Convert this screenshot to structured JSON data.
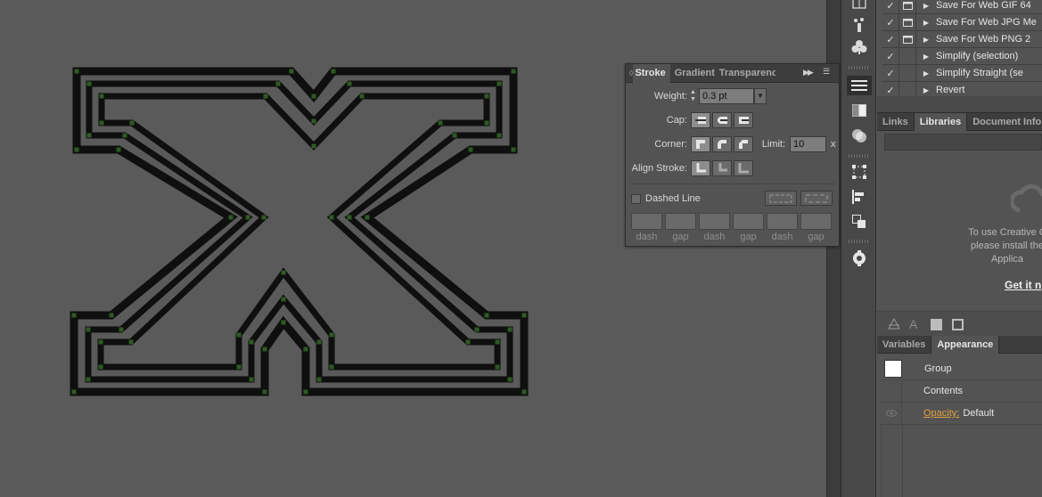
{
  "stroke_panel": {
    "tabs": [
      "Stroke",
      "Gradient",
      "Transparency"
    ],
    "weight_label": "Weight:",
    "weight_value": "0.3 pt",
    "cap_label": "Cap:",
    "corner_label": "Corner:",
    "limit_label": "Limit:",
    "limit_value": "10",
    "limit_unit": "x",
    "align_label": "Align Stroke:",
    "dashed_label": "Dashed Line",
    "dash_labels": [
      "dash",
      "gap",
      "dash",
      "gap",
      "dash",
      "gap"
    ]
  },
  "actions": {
    "items": [
      {
        "label": "Save For Web GIF 64",
        "checked": true,
        "dialog": true
      },
      {
        "label": "Save For Web JPG Me",
        "checked": true,
        "dialog": true
      },
      {
        "label": "Save For Web PNG 2",
        "checked": true,
        "dialog": true
      },
      {
        "label": "Simplify (selection)",
        "checked": true,
        "dialog": false
      },
      {
        "label": "Simplify Straight (se",
        "checked": true,
        "dialog": false
      },
      {
        "label": "Revert",
        "checked": true,
        "dialog": false
      }
    ]
  },
  "libraries_panel": {
    "tabs": [
      "Links",
      "Libraries",
      "Document Info"
    ],
    "message_lines": [
      "To use Creative C",
      "please install the",
      "Applica"
    ],
    "link_text": "Get it n"
  },
  "appearance_panel": {
    "tabs": [
      "Variables",
      "Appearance"
    ],
    "group_label": "Group",
    "contents_label": "Contents",
    "opacity_label": "Opacity:",
    "opacity_value": "Default"
  },
  "colors": {
    "canvas": "#5a5a5a",
    "panel": "#535353",
    "accent_link": "#e0a040",
    "anchor_points": "#2e5a23"
  },
  "icons": {
    "toolstrip": [
      "artboards-icon",
      "symbol-sprayer-icon",
      "club-symbol-icon",
      "stroke-panel-icon",
      "gradient-icon",
      "transparency-icon",
      "transform-icon",
      "align-icon",
      "pathfinder-icon",
      "navigator-icon"
    ]
  }
}
